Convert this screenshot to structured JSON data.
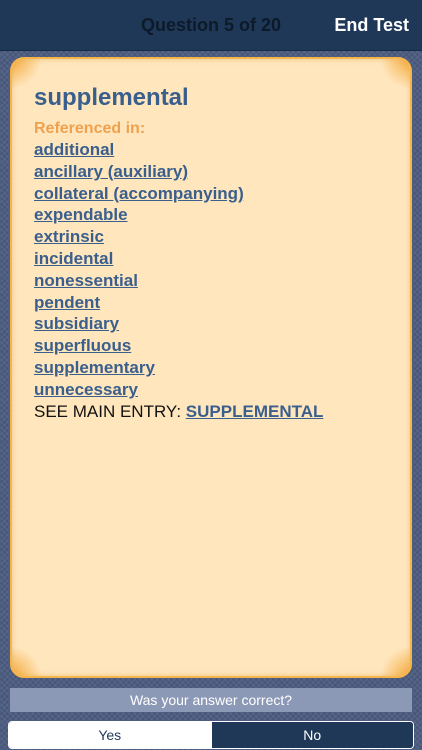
{
  "header": {
    "question_counter": "Question 5 of 20",
    "end_test_label": "End Test"
  },
  "card": {
    "headword": "supplemental",
    "referenced_in_label": "Referenced in:",
    "references": [
      "additional",
      "ancillary (auxiliary)",
      "collateral (accompanying)",
      "expendable",
      "extrinsic",
      "incidental",
      "nonessential",
      "pendent",
      "subsidiary",
      "superfluous",
      "supplementary",
      "unnecessary"
    ],
    "see_main_entry_label": "SEE MAIN ENTRY:",
    "main_entry": "SUPPLEMENTAL"
  },
  "footer": {
    "prompt": "Was your answer correct?",
    "yes_label": "Yes",
    "no_label": "No",
    "selected": "Yes"
  },
  "colors": {
    "top_bar": "#1f3857",
    "card_background": "#ffe6bd",
    "card_border": "#f5b54a",
    "link": "#3a5f8d",
    "referenced_heading": "#eea24f"
  }
}
